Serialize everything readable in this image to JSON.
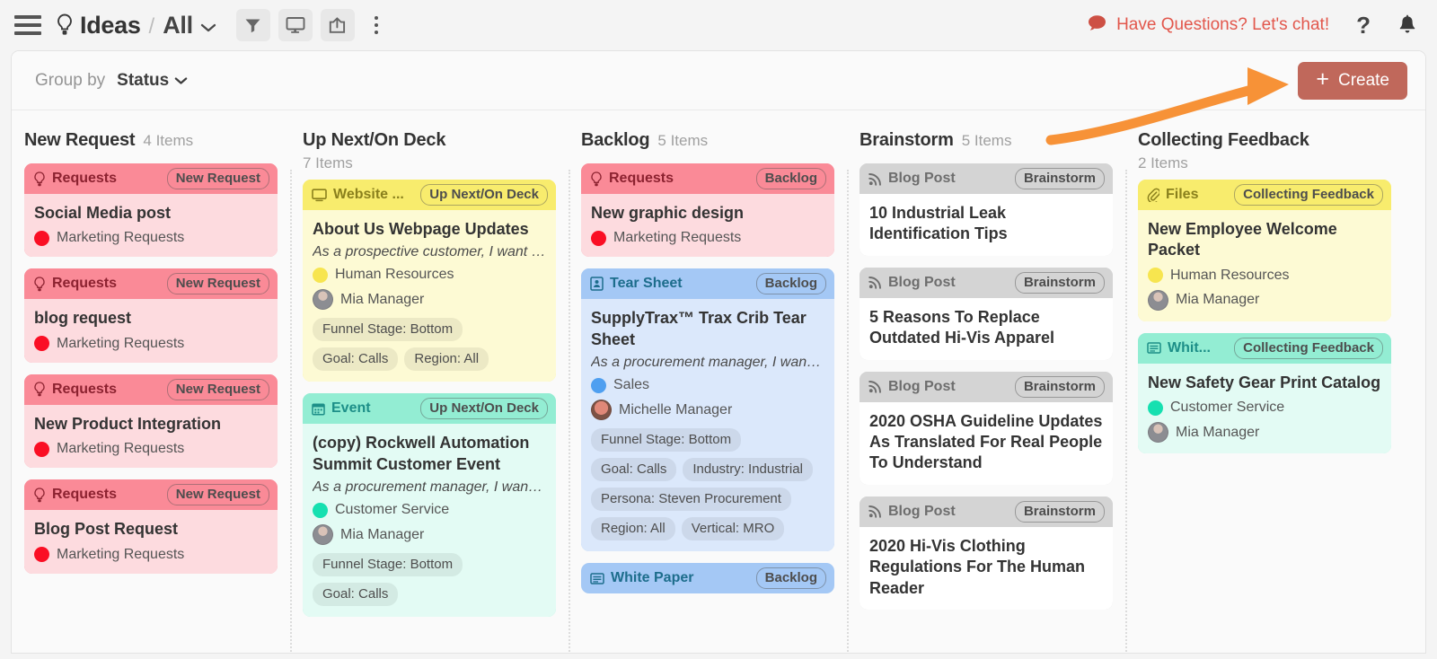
{
  "topbar": {
    "menu_icon": "hamburger-icon",
    "app_icon": "lightbulb-icon",
    "breadcrumb_root": "Ideas",
    "breadcrumb_sep": "/",
    "breadcrumb_current": "All",
    "tools": [
      {
        "name": "filter-icon",
        "label": "Filter"
      },
      {
        "name": "present-icon",
        "label": "Present"
      },
      {
        "name": "share-icon",
        "label": "Share"
      }
    ],
    "more_icon": "kebab-menu-icon",
    "chat_icon": "chat-bubble-icon",
    "chat_text": "Have Questions? Let's chat!",
    "help_label": "?",
    "bell_icon": "bell-icon",
    "accent_color": "#e2574c"
  },
  "panel": {
    "group_by_label": "Group by",
    "group_by_value": "Status",
    "create_label": "Create",
    "create_plus": "+",
    "create_color": "#c0685b",
    "annotation_arrow_color": "#f79237"
  },
  "columns": [
    {
      "title": "New Request",
      "count": "4 Items",
      "count_block": false,
      "cards": [
        {
          "color": "pink",
          "type_icon": "lightbulb-icon",
          "type": "Requests",
          "status": "New Request",
          "title": "Social Media post",
          "desc": null,
          "dot_color": "#fa0f24",
          "dot_label": "Marketing Requests",
          "avatar": null,
          "tags": []
        },
        {
          "color": "pink",
          "type_icon": "lightbulb-icon",
          "type": "Requests",
          "status": "New Request",
          "title": "blog request",
          "desc": null,
          "dot_color": "#fa0f24",
          "dot_label": "Marketing Requests",
          "avatar": null,
          "tags": []
        },
        {
          "color": "pink",
          "type_icon": "lightbulb-icon",
          "type": "Requests",
          "status": "New Request",
          "title": "New Product Integration",
          "desc": null,
          "dot_color": "#fa0f24",
          "dot_label": "Marketing Requests",
          "avatar": null,
          "tags": []
        },
        {
          "color": "pink",
          "type_icon": "lightbulb-icon",
          "type": "Requests",
          "status": "New Request",
          "title": "Blog Post Request",
          "desc": null,
          "dot_color": "#fa0f24",
          "dot_label": "Marketing Requests",
          "avatar": null,
          "tags": []
        }
      ]
    },
    {
      "title": "Up Next/On Deck",
      "count": "7 Items",
      "count_block": true,
      "cards": [
        {
          "color": "yellow",
          "type_icon": "monitor-icon",
          "type": "Website ...",
          "status": "Up Next/On Deck",
          "title": "About Us Webpage Updates",
          "desc": "As a prospective customer, I want …",
          "dot_color": "#f7e54f",
          "dot_label": "Human Resources",
          "avatar": "Mia Manager",
          "tags": [
            "Funnel Stage: Bottom",
            "Goal: Calls",
            "Region: All"
          ]
        },
        {
          "color": "mint",
          "type_icon": "calendar-icon",
          "type": "Event",
          "status": "Up Next/On Deck",
          "title": "(copy) Rockwell Automation Summit Customer Event",
          "desc": "As a procurement manager, I want…",
          "dot_color": "#16e0b0",
          "dot_label": "Customer Service",
          "avatar": "Mia Manager",
          "tags": [
            "Funnel Stage: Bottom",
            "Goal: Calls"
          ]
        }
      ]
    },
    {
      "title": "Backlog",
      "count": "5 Items",
      "count_block": false,
      "cards": [
        {
          "color": "pink",
          "type_icon": "lightbulb-icon",
          "type": "Requests",
          "status": "Backlog",
          "title": "New graphic design",
          "desc": null,
          "dot_color": "#fa0f24",
          "dot_label": "Marketing Requests",
          "avatar": null,
          "tags": []
        },
        {
          "color": "blue",
          "type_icon": "tearsheet-icon",
          "type": "Tear Sheet",
          "status": "Backlog",
          "title": "SupplyTrax™ Trax Crib Tear Sheet",
          "desc": "As a procurement manager, I want…",
          "dot_color": "#4f9ff0",
          "dot_label": "Sales",
          "avatar": "Michelle Manager",
          "avatar_variant": "m2",
          "tags": [
            "Funnel Stage: Bottom",
            "Goal: Calls",
            "Industry: Industrial",
            "Persona: Steven Procurement",
            "Region: All",
            "Vertical: MRO"
          ]
        },
        {
          "color": "blue",
          "type_icon": "whitepaper-icon",
          "type": "White Paper",
          "status": "Backlog",
          "title": null,
          "desc": null,
          "dot_color": null,
          "dot_label": null,
          "avatar": null,
          "tags": [],
          "clipped": true
        }
      ]
    },
    {
      "title": "Brainstorm",
      "count": "5 Items",
      "count_block": false,
      "cards": [
        {
          "color": "gray",
          "type_icon": "rss-icon",
          "type": "Blog Post",
          "status": "Brainstorm",
          "title": "10 Industrial Leak Identification Tips",
          "desc": null,
          "dot_color": null,
          "dot_label": null,
          "avatar": null,
          "tags": []
        },
        {
          "color": "gray",
          "type_icon": "rss-icon",
          "type": "Blog Post",
          "status": "Brainstorm",
          "title": "5 Reasons To Replace Outdated Hi-Vis Apparel",
          "desc": null,
          "dot_color": null,
          "dot_label": null,
          "avatar": null,
          "tags": []
        },
        {
          "color": "gray",
          "type_icon": "rss-icon",
          "type": "Blog Post",
          "status": "Brainstorm",
          "title": "2020 OSHA Guideline Updates As Translated For Real People To Understand",
          "desc": null,
          "dot_color": null,
          "dot_label": null,
          "avatar": null,
          "tags": []
        },
        {
          "color": "gray",
          "type_icon": "rss-icon",
          "type": "Blog Post",
          "status": "Brainstorm",
          "title": "2020 Hi-Vis Clothing Regulations For The Human Reader",
          "desc": null,
          "dot_color": null,
          "dot_label": null,
          "avatar": null,
          "tags": []
        }
      ]
    },
    {
      "title": "Collecting Feedback",
      "count": "2 Items",
      "count_block": true,
      "cards": [
        {
          "color": "yellow",
          "type_icon": "paperclip-icon",
          "type": "Files",
          "status": "Collecting Feedback",
          "title": "New Employee Welcome Packet",
          "desc": null,
          "dot_color": "#f7e54f",
          "dot_label": "Human Resources",
          "avatar": "Mia Manager",
          "tags": []
        },
        {
          "color": "mint",
          "type_icon": "whiteboard-icon",
          "type": "Whit...",
          "status": "Collecting Feedback",
          "title": "New Safety Gear Print Catalog",
          "desc": null,
          "dot_color": "#16e0b0",
          "dot_label": "Customer Service",
          "avatar": "Mia Manager",
          "tags": []
        }
      ]
    }
  ]
}
